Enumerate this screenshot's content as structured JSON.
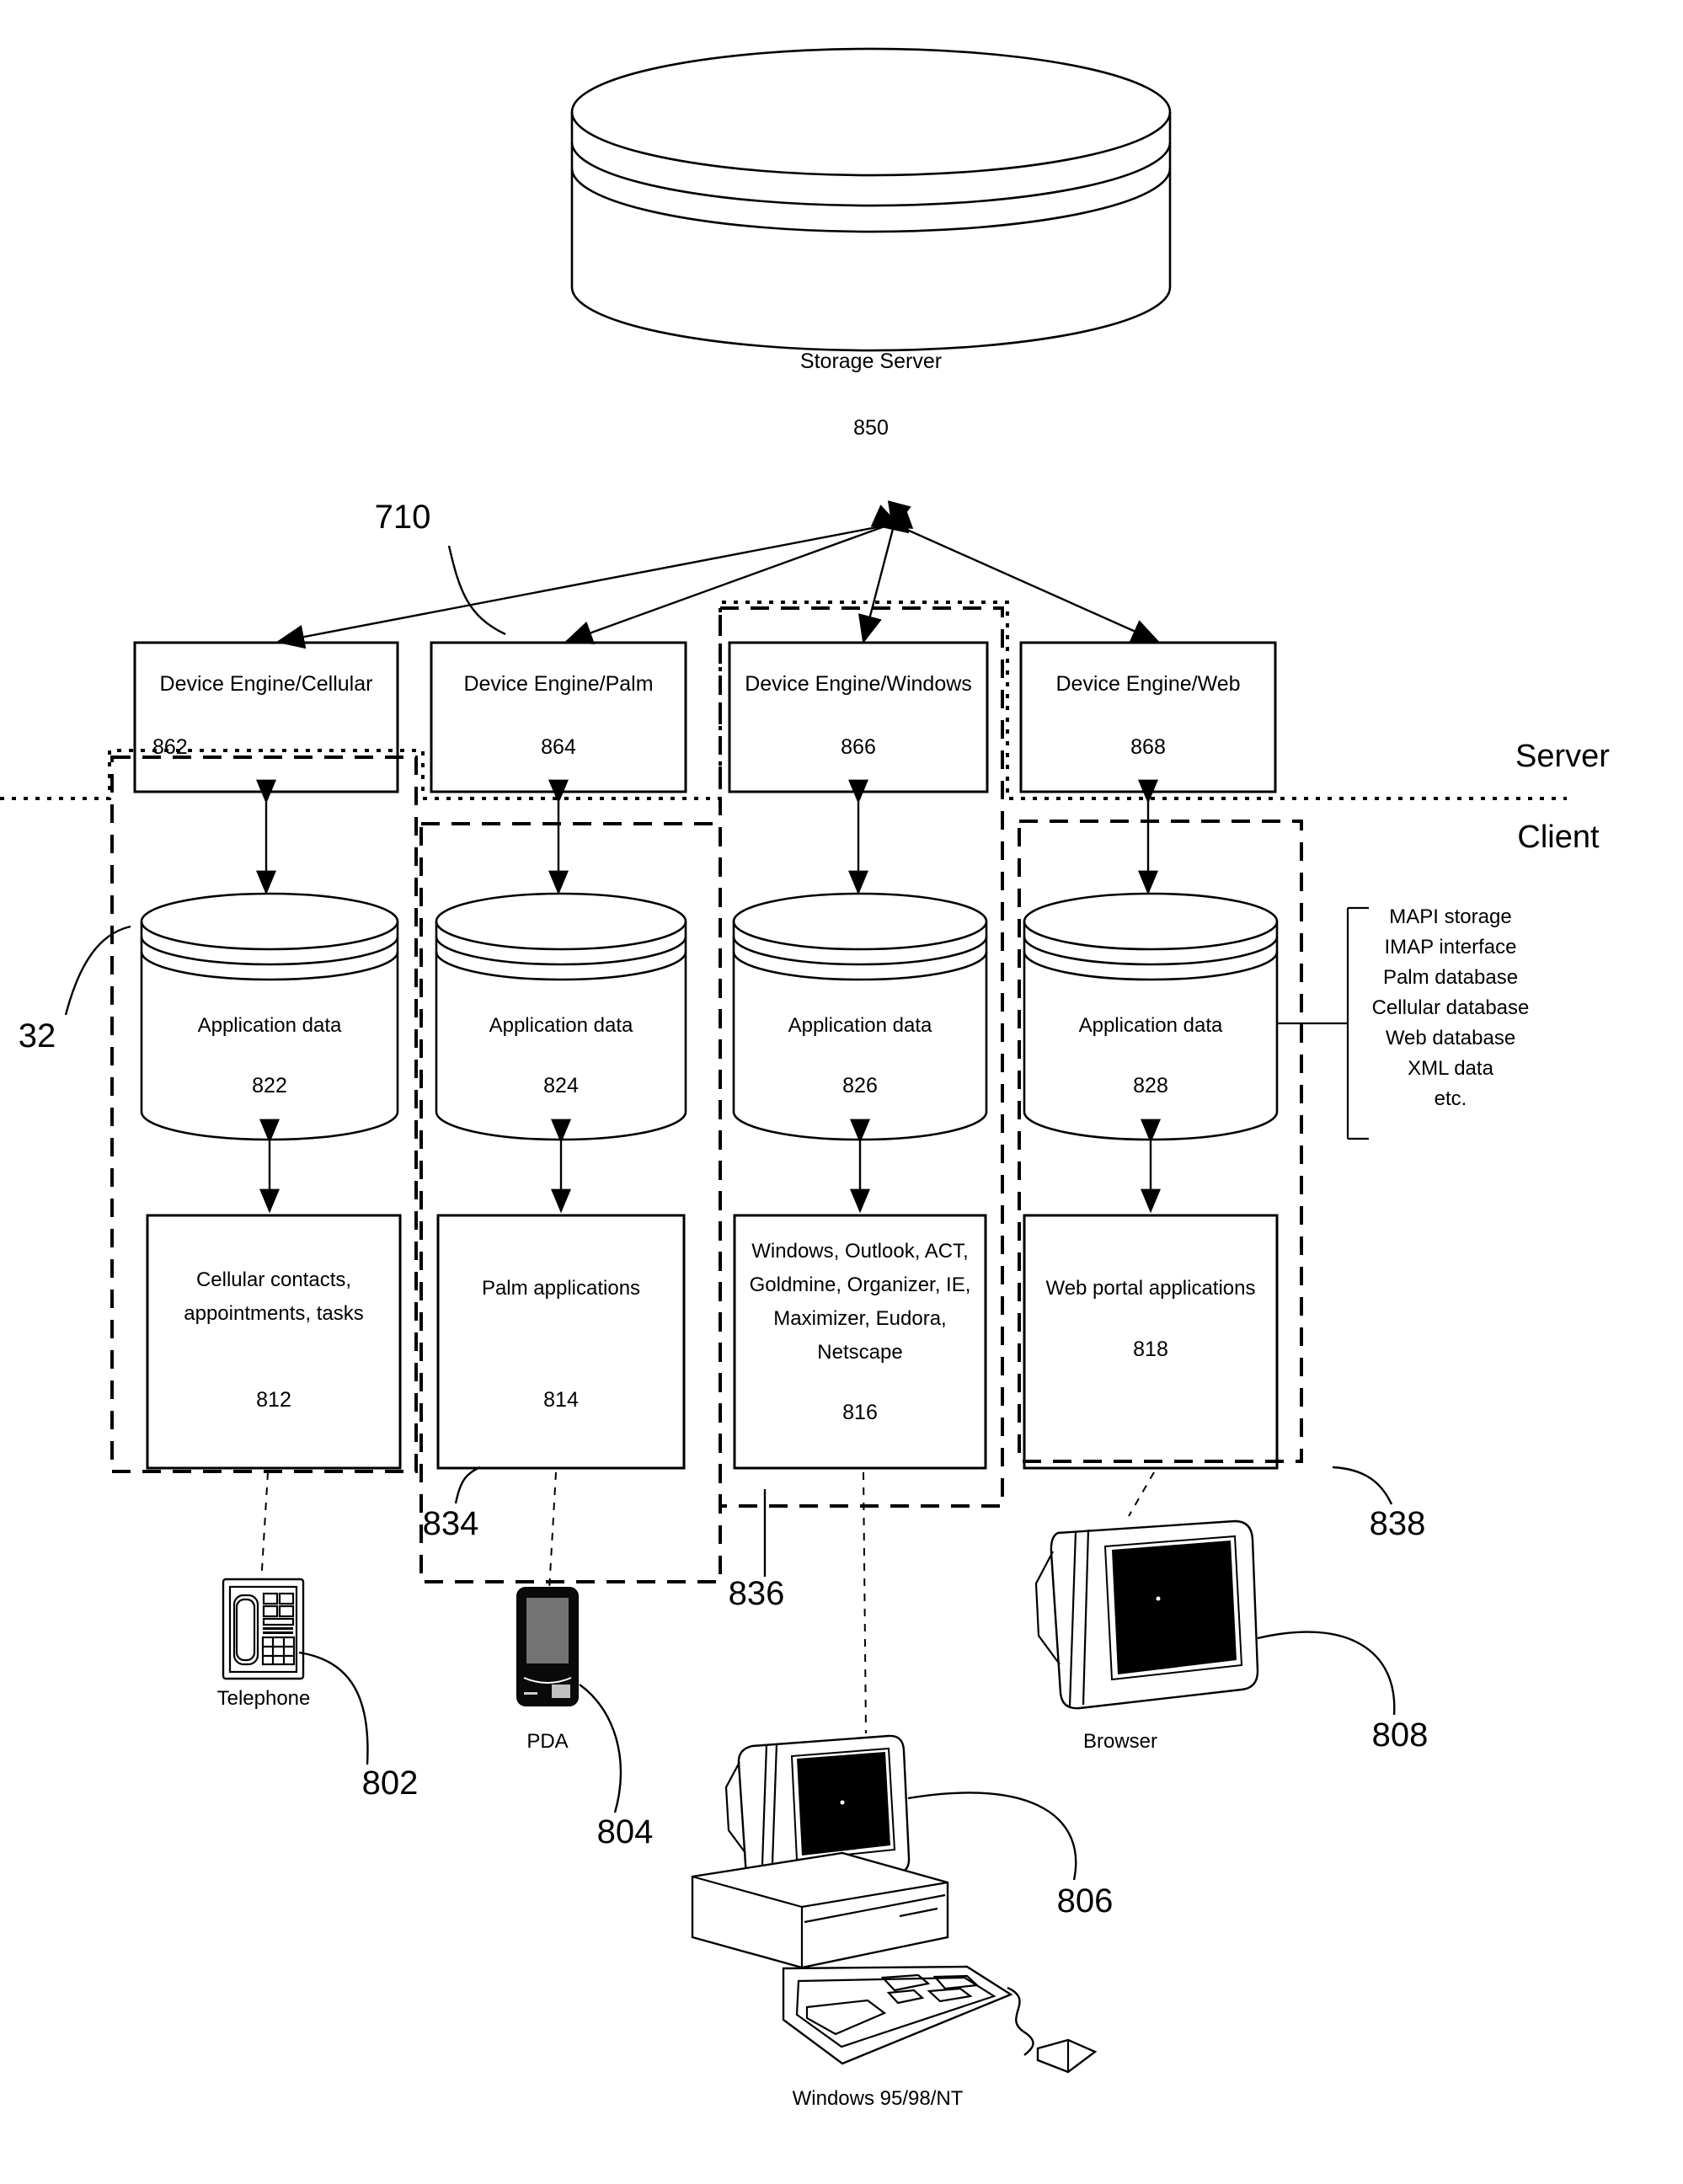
{
  "figure": {
    "top_ref": "710",
    "left_ref": "32",
    "side_labels": {
      "server": "Server",
      "client": "Client"
    }
  },
  "storage_server": {
    "title": "Storage Server",
    "ref": "850"
  },
  "device_engines": [
    {
      "title": "Device Engine/Cellular",
      "ref": "862"
    },
    {
      "title": "Device Engine/Palm",
      "ref": "864"
    },
    {
      "title": "Device Engine/Windows",
      "ref": "866"
    },
    {
      "title": "Device Engine/Web",
      "ref": "868"
    }
  ],
  "application_data": [
    {
      "title": "Application data",
      "ref": "822"
    },
    {
      "title": "Application data",
      "ref": "824"
    },
    {
      "title": "Application data",
      "ref": "826"
    },
    {
      "title": "Application data",
      "ref": "828"
    }
  ],
  "applications": [
    {
      "lines": [
        "Cellular contacts,",
        "appointments, tasks"
      ],
      "ref": "812"
    },
    {
      "lines": [
        "Palm applications"
      ],
      "ref": "814"
    },
    {
      "lines": [
        "Windows, Outlook, ACT,",
        "Goldmine, Organizer, IE,",
        "Maximizer, Eudora,",
        "Netscape"
      ],
      "ref": "816"
    },
    {
      "lines": [
        "Web portal applications"
      ],
      "ref": "818"
    }
  ],
  "storage_types": [
    "MAPI storage",
    "IMAP interface",
    "Palm database",
    "Cellular database",
    "Web database",
    "XML data",
    "etc."
  ],
  "devices": [
    {
      "name": "Telephone",
      "ref": "802"
    },
    {
      "name": "PDA",
      "ref": "804"
    },
    {
      "name": "Windows 95/98/NT",
      "ref": "806"
    },
    {
      "name": "Browser",
      "ref": "808"
    }
  ],
  "region_refs": [
    "834",
    "836",
    "838"
  ],
  "colors": {
    "ink": "#000000",
    "paper": "#ffffff"
  }
}
